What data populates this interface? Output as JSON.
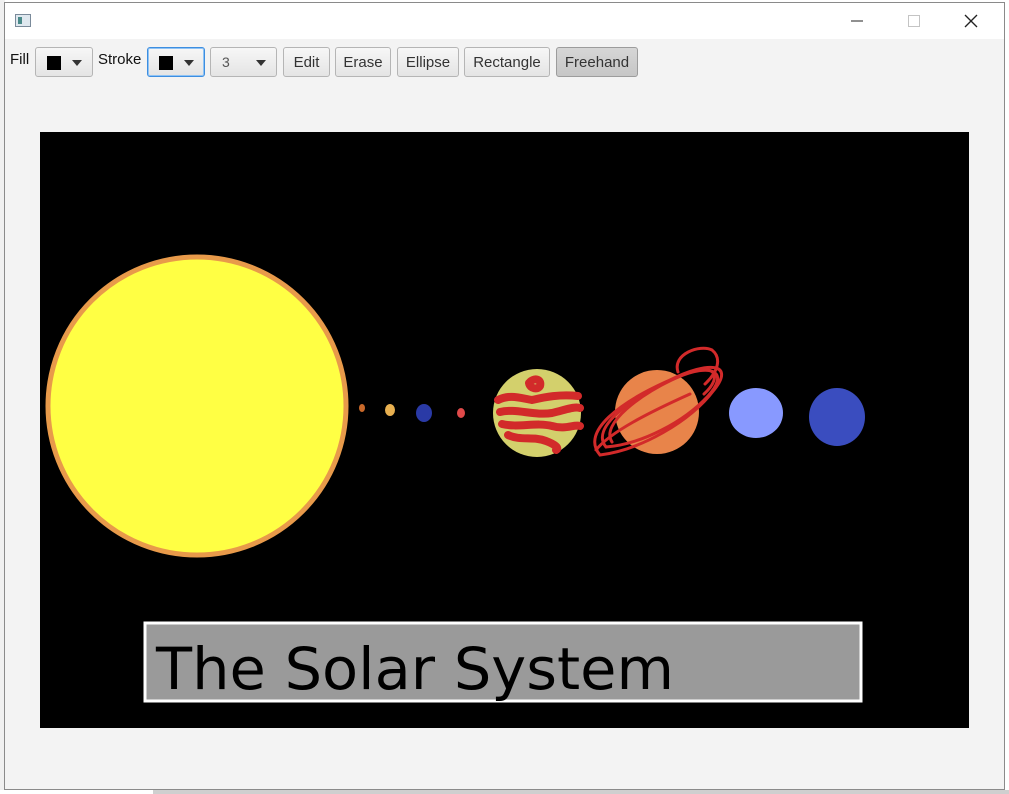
{
  "toolbar": {
    "fill_label": "Fill",
    "stroke_label": "Stroke",
    "fill_color": "#000000",
    "stroke_color": "#000000",
    "stroke_width": "3",
    "buttons": [
      "Edit",
      "Erase",
      "Ellipse",
      "Rectangle",
      "Freehand"
    ],
    "selected_tool": "Freehand"
  },
  "window": {
    "controls": [
      "minimize-icon",
      "maximize-icon",
      "close-icon"
    ]
  },
  "canvas": {
    "background": "#000000",
    "drawing_text": "The Solar System",
    "colors": {
      "sun_fill": "#ffff44",
      "sun_stroke": "#e89a4a",
      "jupiter_fill": "#d3d06c",
      "saturn_fill": "#e8844a",
      "uranus_fill": "#8899ff",
      "neptune_fill": "#3a4dbf",
      "freehand_red": "#d22a2a",
      "label_box_fill": "#9a9a9a",
      "label_box_stroke": "#ffffff"
    }
  }
}
